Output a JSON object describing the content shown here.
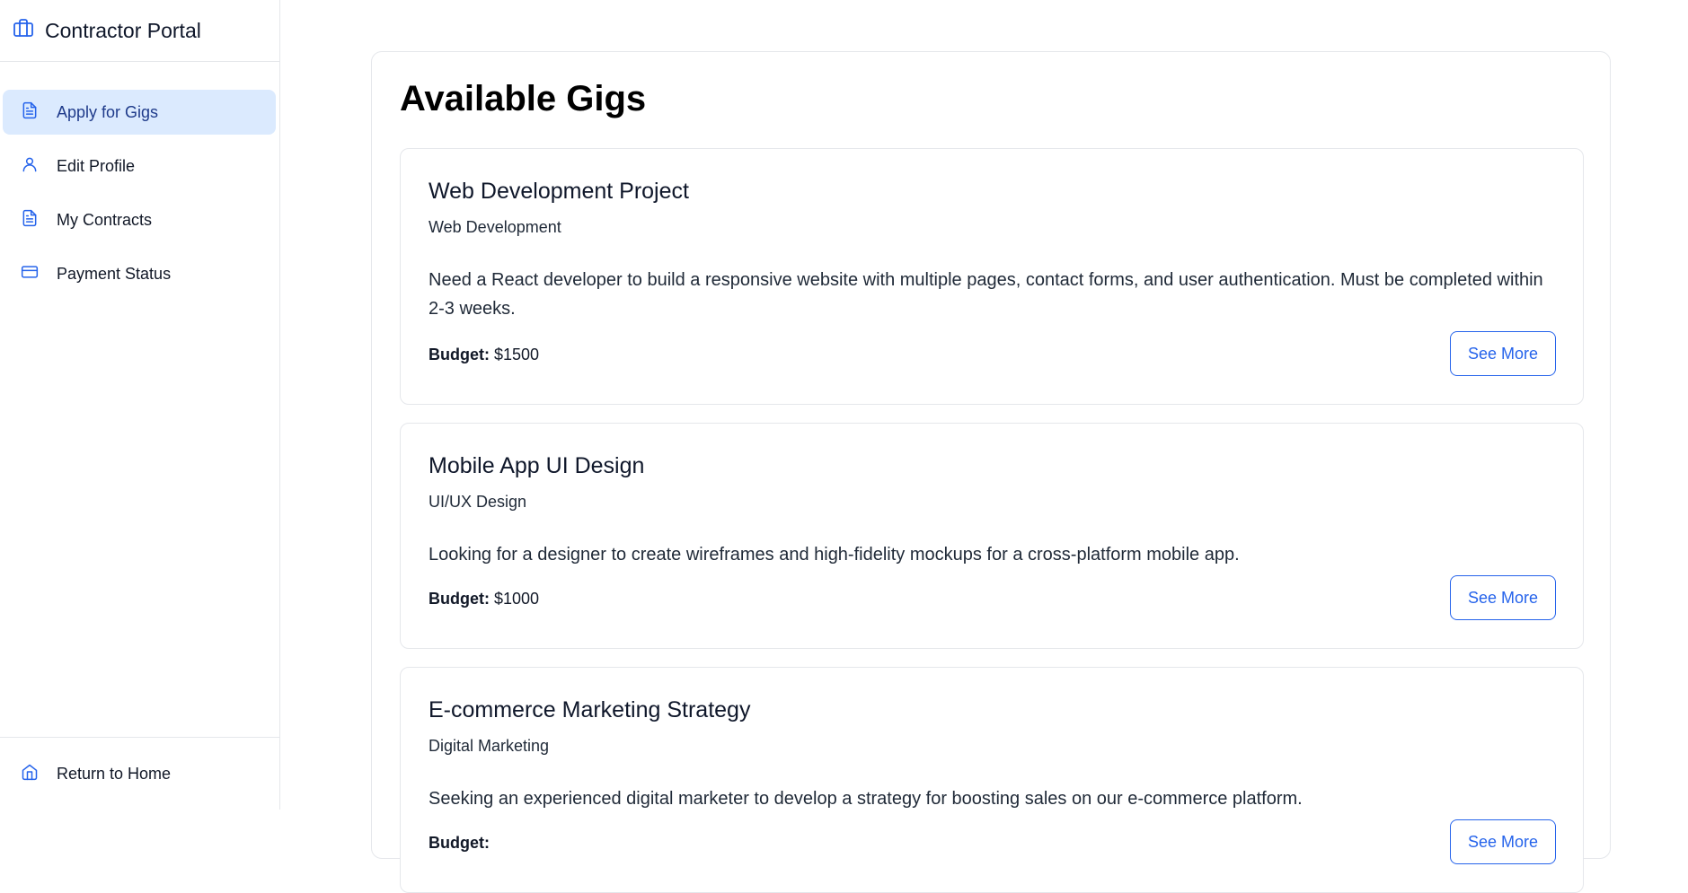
{
  "app": {
    "title": "Contractor Portal",
    "icon": "briefcase-icon",
    "accent": "#2563eb",
    "active_bg": "#dbeafe"
  },
  "sidebar": {
    "items": [
      {
        "label": "Apply for Gigs",
        "icon": "file-text-icon",
        "active": true
      },
      {
        "label": "Edit Profile",
        "icon": "user-icon",
        "active": false
      },
      {
        "label": "My Contracts",
        "icon": "file-text-icon",
        "active": false
      },
      {
        "label": "Payment Status",
        "icon": "credit-card-icon",
        "active": false
      }
    ],
    "footer": {
      "label": "Return to Home",
      "icon": "home-icon"
    }
  },
  "main": {
    "title": "Available Gigs",
    "gigs": [
      {
        "title": "Web Development Project",
        "category": "Web Development",
        "description": "Need a React developer to build a responsive website with multiple pages, contact forms, and user authentication. Must be completed within 2-3 weeks.",
        "budget_label": "Budget:",
        "budget_value": "$1500",
        "button": "See More"
      },
      {
        "title": "Mobile App UI Design",
        "category": "UI/UX Design",
        "description": "Looking for a designer to create wireframes and high-fidelity mockups for a cross-platform mobile app.",
        "budget_label": "Budget:",
        "budget_value": "$1000",
        "button": "See More"
      },
      {
        "title": "E-commerce Marketing Strategy",
        "category": "Digital Marketing",
        "description": "Seeking an experienced digital marketer to develop a strategy for boosting sales on our e-commerce platform.",
        "budget_label": "Budget:",
        "budget_value": "",
        "button": "See More"
      }
    ]
  }
}
